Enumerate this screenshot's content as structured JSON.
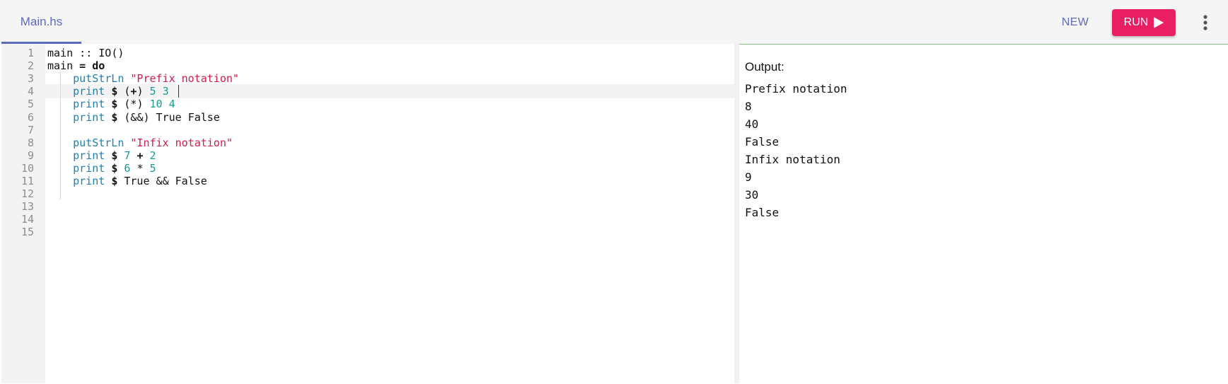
{
  "header": {
    "tab_label": "Main.hs",
    "new_label": "NEW",
    "run_label": "RUN",
    "menu_icon": "more-vert-icon",
    "play_icon": "play-icon",
    "accent_color": "#5c6bc0",
    "run_color": "#e91e63"
  },
  "editor": {
    "lines": [
      {
        "n": "1",
        "t": "main :: IO()"
      },
      {
        "n": "2",
        "t": "main = do"
      },
      {
        "n": "3",
        "t": "    putStrLn \"Prefix notation\""
      },
      {
        "n": "4",
        "t": "    print $ (+) 5 3"
      },
      {
        "n": "5",
        "t": "    print $ (*) 10 4"
      },
      {
        "n": "6",
        "t": "    print $ (&&) True False"
      },
      {
        "n": "7",
        "t": ""
      },
      {
        "n": "8",
        "t": "    putStrLn \"Infix notation\""
      },
      {
        "n": "9",
        "t": "    print $ 7 + 2"
      },
      {
        "n": "10",
        "t": "    print $ 6 * 5"
      },
      {
        "n": "11",
        "t": "    print $ True && False"
      },
      {
        "n": "12",
        "t": ""
      },
      {
        "n": "13",
        "t": ""
      },
      {
        "n": "14",
        "t": ""
      },
      {
        "n": "15",
        "t": ""
      }
    ]
  },
  "output": {
    "title": "Output:",
    "lines": [
      "Prefix notation",
      "8",
      "40",
      "False",
      "Infix notation",
      "9",
      "30",
      "False"
    ]
  }
}
